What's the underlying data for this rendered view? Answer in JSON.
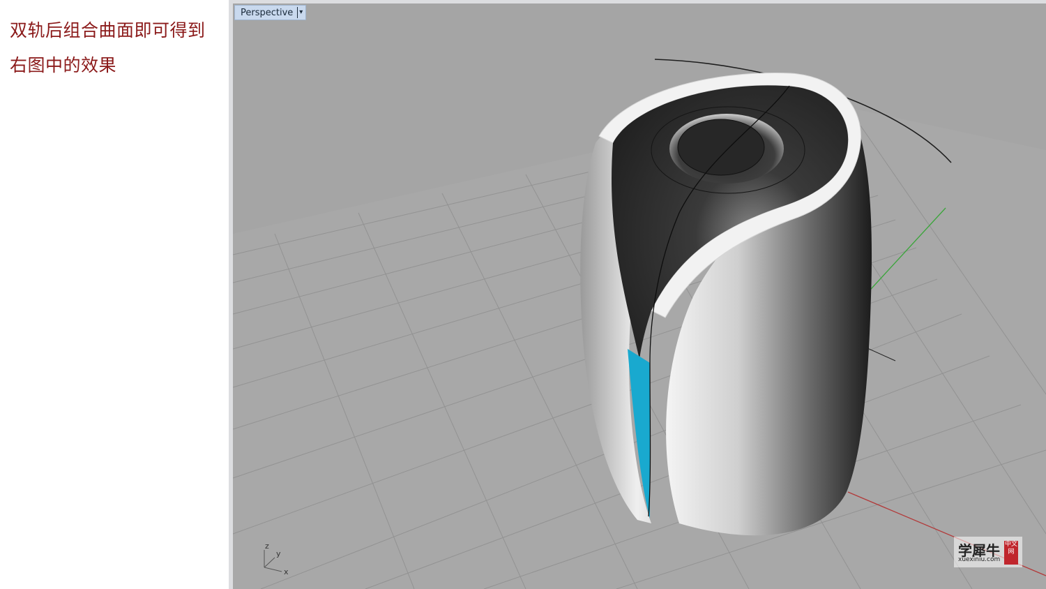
{
  "caption": {
    "line1": "双轨后组合曲面即可得到",
    "line2": "右图中的效果"
  },
  "viewport": {
    "label": "Perspective",
    "menu_arrow": "▾",
    "axes": {
      "z": "z",
      "y": "y",
      "x": "x"
    },
    "colors": {
      "background": "#a5a5a5",
      "grid": "#8f8f8f",
      "x_axis": "#b23a3a",
      "y_axis": "#3aa53a",
      "highlight": "#19a9cf"
    }
  },
  "watermark": {
    "brand": "学犀牛",
    "url": "xuexiniu.com",
    "seal": "中文网"
  }
}
